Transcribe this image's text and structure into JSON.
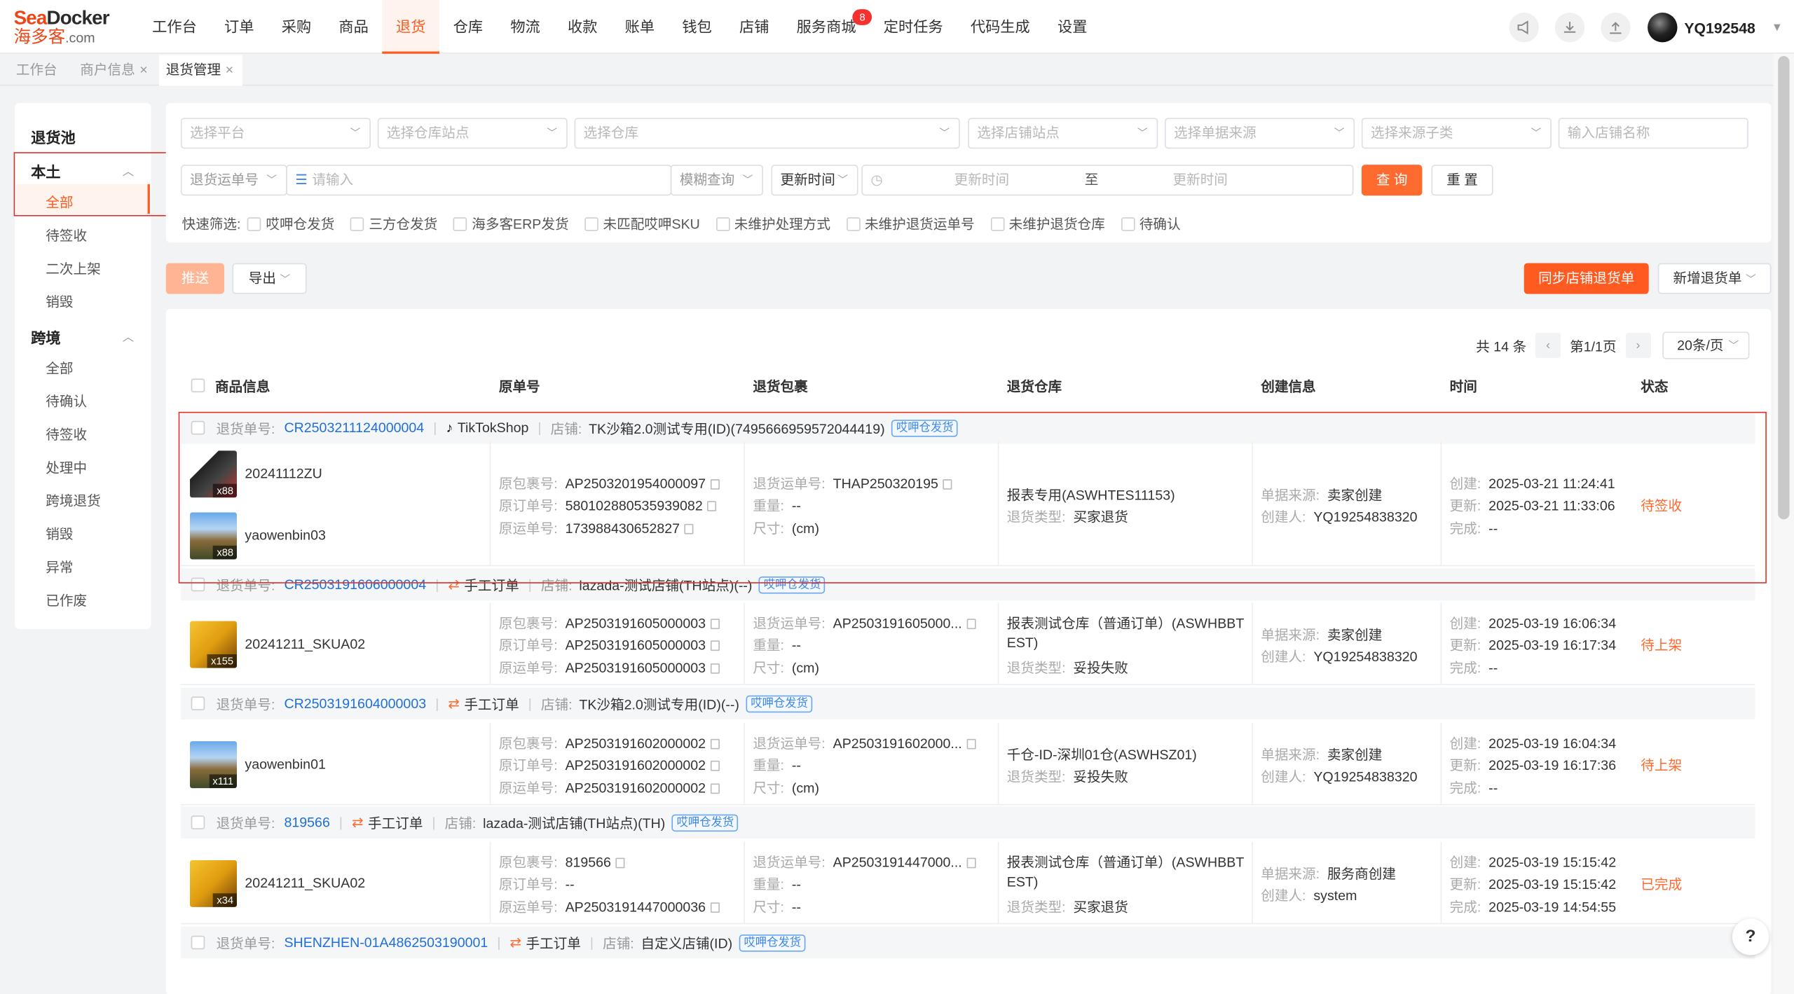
{
  "logo": {
    "en_a": "Sea",
    "en_b": "Docker",
    "cn": "海多客",
    "suffix": ".com"
  },
  "nav": [
    "工作台",
    "订单",
    "采购",
    "商品",
    "退货",
    "仓库",
    "物流",
    "收款",
    "账单",
    "钱包",
    "店铺",
    "服务商城",
    "定时任务",
    "代码生成",
    "设置"
  ],
  "nav_badge": "8",
  "user": {
    "name": "YQ192548"
  },
  "tabs": [
    {
      "label": "工作台"
    },
    {
      "label": "商户信息"
    },
    {
      "label": "退货管理"
    }
  ],
  "sidebar": {
    "pool": "退货池",
    "local": "本土",
    "local_items": [
      "全部",
      "待签收",
      "二次上架",
      "销毁"
    ],
    "cross": "跨境",
    "cross_items": [
      "全部",
      "待确认",
      "待签收",
      "处理中",
      "跨境退货",
      "销毁",
      "异常",
      "已作废"
    ]
  },
  "filters": {
    "platform": "选择平台",
    "warehouse_site": "选择仓库站点",
    "warehouse": "选择仓库",
    "shop_site": "选择店铺站点",
    "source": "选择单据来源",
    "source_sub": "选择来源子类",
    "shop_name": "输入店铺名称",
    "return_no_type": "退货运单号",
    "input_ph": "请输入",
    "match": "模糊查询",
    "time_type": "更新时间",
    "time_start": "更新时间",
    "time_to": "至",
    "time_end": "更新时间",
    "query": "查 询",
    "reset": "重 置"
  },
  "quick": {
    "label": "快速筛选:",
    "options": [
      "哎呷仓发货",
      "三方仓发货",
      "海多客ERP发货",
      "未匹配哎呷SKU",
      "未维护处理方式",
      "未维护退货运单号",
      "未维护退货仓库",
      "待确认"
    ]
  },
  "toolbar": {
    "push": "推送",
    "export": "导出",
    "sync": "同步店铺退货单",
    "new": "新增退货单"
  },
  "pager": {
    "total": "共 14 条",
    "page": "第1/1页",
    "size": "20条/页"
  },
  "headers": [
    "商品信息",
    "原单号",
    "退货包裹",
    "退货仓库",
    "创建信息",
    "时间",
    "状态"
  ],
  "labels": {
    "ret_no": "退货单号:",
    "shop": "店铺:",
    "pkg": "原包裹号:",
    "ord": "原订单号:",
    "waybill": "原运单号:",
    "ret_waybill": "退货运单号:",
    "weight": "重量:",
    "size": "尺寸:",
    "ret_type": "退货类型:",
    "src": "单据来源:",
    "creator": "创建人:",
    "created": "创建:",
    "updated": "更新:",
    "done": "完成:"
  },
  "orders": [
    {
      "no": "CR2503211124000004",
      "source": "TikTokShop",
      "shop": "TK沙箱2.0测试专用(ID)(7495666959572044419)",
      "tag": "哎呷仓发货",
      "items": [
        {
          "sku": "20241112ZU",
          "qty": "x88"
        },
        {
          "sku": "yaowenbin03",
          "qty": "x88"
        }
      ],
      "pkg": "AP2503201954000097",
      "ord": "580102880535939082",
      "waybill": "173988430652827",
      "ret_waybill": "THAP250320195",
      "weight": "--",
      "size": "(cm)",
      "warehouse": "报表专用(ASWHTES11153)",
      "ret_type": "买家退货",
      "src": "卖家创建",
      "creator": "YQ19254838320",
      "created": "2025-03-21 11:24:41",
      "updated": "2025-03-21 11:33:06",
      "done": "--",
      "status": "待签收"
    },
    {
      "no": "CR2503191606000004",
      "source": "手工订单",
      "shop": "lazada-测试店铺(TH站点)(--)",
      "tag": "哎呷仓发货",
      "items": [
        {
          "sku": "20241211_SKUA02",
          "qty": "x155"
        }
      ],
      "pkg": "AP2503191605000003",
      "ord": "AP2503191605000003",
      "waybill": "AP2503191605000003",
      "ret_waybill": "AP2503191605000...",
      "weight": "--",
      "size": "(cm)",
      "warehouse": "报表测试仓库（普通订单）(ASWHBBT",
      "warehouse2": "EST)",
      "ret_type": "妥投失败",
      "src": "卖家创建",
      "creator": "YQ19254838320",
      "created": "2025-03-19 16:06:34",
      "updated": "2025-03-19 16:17:34",
      "done": "--",
      "status": "待上架"
    },
    {
      "no": "CR2503191604000003",
      "source": "手工订单",
      "shop": "TK沙箱2.0测试专用(ID)(--)",
      "tag": "哎呷仓发货",
      "items": [
        {
          "sku": "yaowenbin01",
          "qty": "x111"
        }
      ],
      "pkg": "AP2503191602000002",
      "ord": "AP2503191602000002",
      "waybill": "AP2503191602000002",
      "ret_waybill": "AP2503191602000...",
      "weight": "--",
      "size": "(cm)",
      "warehouse": "千仓-ID-深圳01仓(ASWHSZ01)",
      "ret_type": "妥投失败",
      "src": "卖家创建",
      "creator": "YQ19254838320",
      "created": "2025-03-19 16:04:34",
      "updated": "2025-03-19 16:17:36",
      "done": "--",
      "status": "待上架"
    },
    {
      "no": "819566",
      "source": "手工订单",
      "shop": "lazada-测试店铺(TH站点)(TH)",
      "tag": "哎呷仓发货",
      "items": [
        {
          "sku": "20241211_SKUA02",
          "qty": "x34"
        }
      ],
      "pkg": "819566",
      "ord": "--",
      "waybill": "AP2503191447000036",
      "ret_waybill": "AP2503191447000...",
      "weight": "--",
      "size": "--",
      "warehouse": "报表测试仓库（普通订单）(ASWHBBT",
      "warehouse2": "EST)",
      "ret_type": "买家退货",
      "src": "服务商创建",
      "creator": "system",
      "created": "2025-03-19 15:15:42",
      "updated": "2025-03-19 15:15:42",
      "done": "2025-03-19 14:54:55",
      "status": "已完成"
    },
    {
      "no": "SHENZHEN-01A4862503190001",
      "source": "手工订单",
      "shop": "自定义店铺(ID)",
      "tag": "哎呷仓发货"
    }
  ],
  "help": "?"
}
